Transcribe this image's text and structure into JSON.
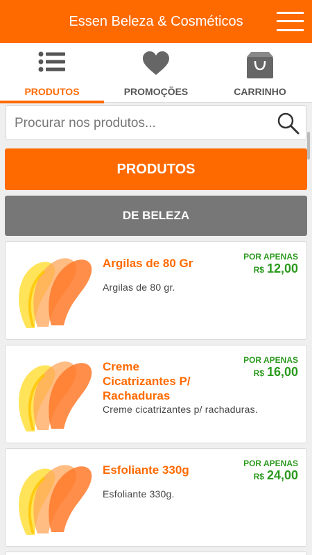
{
  "header": {
    "title": "Essen Beleza & Cosméticos"
  },
  "tabs": [
    {
      "label": "PRODUTOS",
      "icon": "list-icon",
      "active": true
    },
    {
      "label": "PROMOÇÕES",
      "icon": "heart-icon",
      "active": false
    },
    {
      "label": "CARRINHO",
      "icon": "shopping-bag-icon",
      "active": false
    }
  ],
  "search": {
    "placeholder": "Procurar nos produtos...",
    "value": ""
  },
  "buttons": {
    "produtos": "PRODUTOS",
    "categoria": "DE BELEZA"
  },
  "products": [
    {
      "name": "Argilas de 80 Gr",
      "description": "Argilas de 80 gr.",
      "price_prefix": "POR APENAS",
      "currency": "R$",
      "price": "12,00"
    },
    {
      "name": "Creme Cicatrizantes P/ Rachaduras",
      "description": "Creme cicatrizantes p/ rachaduras.",
      "price_prefix": "POR APENAS",
      "currency": "R$",
      "price": "16,00"
    },
    {
      "name": "Esfoliante 330g",
      "description": "Esfoliante 330g.",
      "price_prefix": "POR APENAS",
      "currency": "R$",
      "price": "24,00"
    }
  ],
  "colors": {
    "brand": "#ff6a00",
    "price": "#2b9a1e",
    "secondary_button": "#777777"
  }
}
